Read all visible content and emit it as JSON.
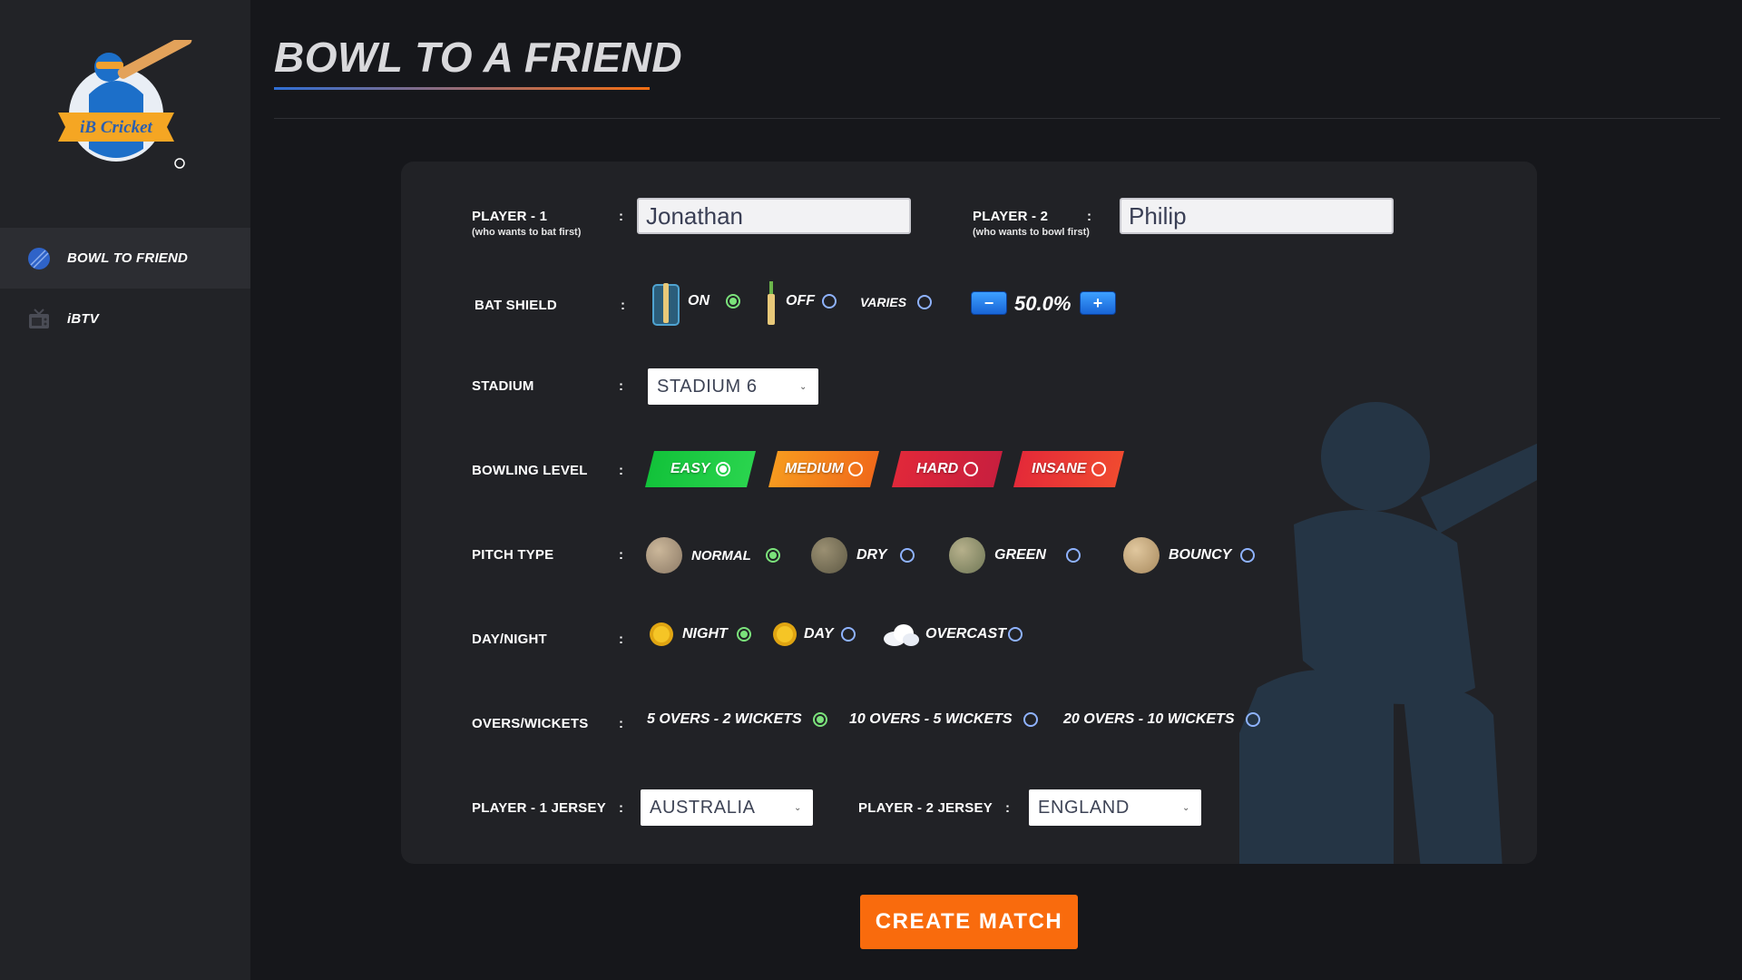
{
  "page_title": "BOWL TO A FRIEND",
  "logo_text": "iB Cricket",
  "sidebar": {
    "items": [
      {
        "label": "BOWL TO FRIEND",
        "icon": "cricket-ball-icon",
        "active": true
      },
      {
        "label": "iBTV",
        "icon": "tv-icon",
        "active": false
      }
    ]
  },
  "form": {
    "player1": {
      "label": "PLAYER - 1",
      "sublabel": "(who wants to bat first)",
      "value": "Jonathan"
    },
    "player2": {
      "label": "PLAYER - 2",
      "sublabel": "(who wants to bowl first)",
      "value": "Philip"
    },
    "colon": ":",
    "bat_shield": {
      "label": "BAT SHIELD",
      "options": [
        {
          "label": "ON",
          "selected": true
        },
        {
          "label": "OFF",
          "selected": false
        },
        {
          "label": "VARIES",
          "selected": false
        }
      ],
      "percent": "50.0%",
      "minus": "−",
      "plus": "+"
    },
    "stadium": {
      "label": "STADIUM",
      "value": "STADIUM 6"
    },
    "bowling_level": {
      "label": "BOWLING LEVEL",
      "options": [
        {
          "label": "EASY",
          "selected": true,
          "color": "#1fbf3a"
        },
        {
          "label": "MEDIUM",
          "selected": false,
          "color": "#f5841f"
        },
        {
          "label": "HARD",
          "selected": false,
          "color": "#e02a3c"
        },
        {
          "label": "INSANE",
          "selected": false,
          "color": "#e8263a"
        }
      ]
    },
    "pitch_type": {
      "label": "PITCH TYPE",
      "options": [
        {
          "label": "NORMAL",
          "selected": true
        },
        {
          "label": "DRY",
          "selected": false
        },
        {
          "label": "GREEN",
          "selected": false
        },
        {
          "label": "BOUNCY",
          "selected": false
        }
      ]
    },
    "day_night": {
      "label": "DAY/NIGHT",
      "options": [
        {
          "label": "NIGHT",
          "selected": true,
          "icon": "sun-icon"
        },
        {
          "label": "DAY",
          "selected": false,
          "icon": "sun-icon"
        },
        {
          "label": "OVERCAST",
          "selected": false,
          "icon": "cloud-icon"
        }
      ]
    },
    "overs_wickets": {
      "label": "OVERS/WICKETS",
      "options": [
        {
          "label": "5 OVERS - 2 WICKETS",
          "selected": true
        },
        {
          "label": "10 OVERS - 5 WICKETS",
          "selected": false
        },
        {
          "label": "20 OVERS - 10 WICKETS",
          "selected": false
        }
      ]
    },
    "player1_jersey": {
      "label": "PLAYER - 1  JERSEY",
      "value": "AUSTRALIA"
    },
    "player2_jersey": {
      "label": "PLAYER - 2  JERSEY",
      "value": "ENGLAND"
    }
  },
  "create_button": "CREATE MATCH",
  "colors": {
    "accent": "#f96b0d",
    "panel": "#212226",
    "sidebar": "#222327",
    "background": "#16171b"
  }
}
